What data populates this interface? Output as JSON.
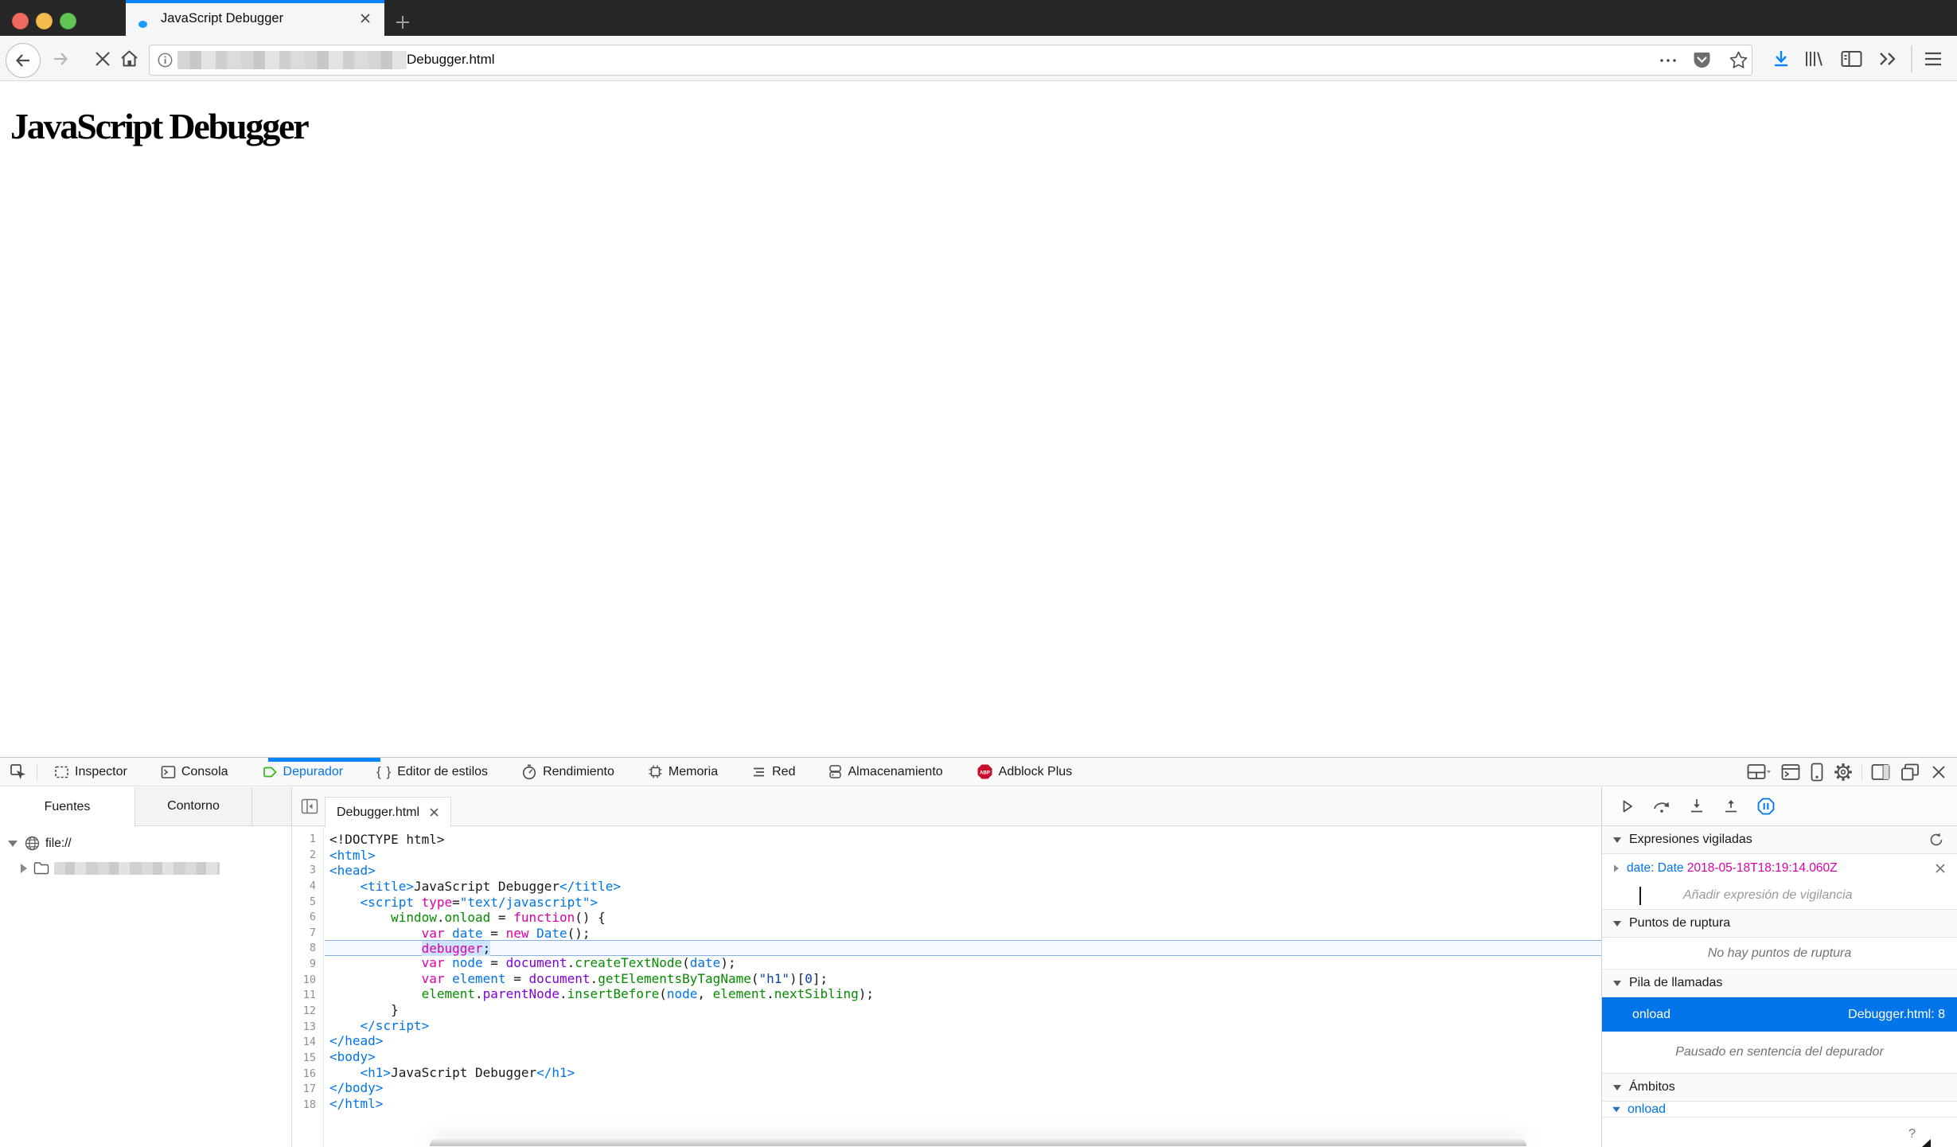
{
  "titlebar": {
    "tab_title": "JavaScript Debugger"
  },
  "navbar": {
    "url_tail": "Debugger.html"
  },
  "page": {
    "heading": "JavaScript Debugger"
  },
  "devtools": {
    "tabs": [
      {
        "id": "inspector",
        "label": "Inspector",
        "active": false
      },
      {
        "id": "console",
        "label": "Consola",
        "active": false
      },
      {
        "id": "debugger",
        "label": "Depurador",
        "active": true
      },
      {
        "id": "styleeditor",
        "label": "Editor de estilos",
        "active": false
      },
      {
        "id": "performance",
        "label": "Rendimiento",
        "active": false
      },
      {
        "id": "memory",
        "label": "Memoria",
        "active": false
      },
      {
        "id": "network",
        "label": "Red",
        "active": false
      },
      {
        "id": "storage",
        "label": "Almacenamiento",
        "active": false
      },
      {
        "id": "adblock",
        "label": "Adblock Plus",
        "active": false
      }
    ],
    "sources": {
      "tab_sources": "Fuentes",
      "tab_outline": "Contorno",
      "root": "file://"
    },
    "editor": {
      "tab": "Debugger.html",
      "paused_line": 8,
      "lines": [
        {
          "n": 1,
          "t": [
            [
              "p",
              "<!DOCTYPE html>"
            ]
          ]
        },
        {
          "n": 2,
          "t": [
            [
              "t",
              "<html>"
            ]
          ]
        },
        {
          "n": 3,
          "t": [
            [
              "t",
              "<head>"
            ]
          ]
        },
        {
          "n": 4,
          "t": [
            [
              "p",
              "    "
            ],
            [
              "t",
              "<title>"
            ],
            [
              "p",
              "JavaScript Debugger"
            ],
            [
              "t",
              "</title>"
            ]
          ]
        },
        {
          "n": 5,
          "t": [
            [
              "p",
              "    "
            ],
            [
              "t",
              "<script"
            ],
            [
              "p",
              " "
            ],
            [
              "a",
              "type"
            ],
            [
              "p",
              "="
            ],
            [
              "sh",
              "\"text/javascript\""
            ],
            [
              "t",
              ">"
            ]
          ]
        },
        {
          "n": 6,
          "t": [
            [
              "p",
              "        "
            ],
            [
              "g",
              "window"
            ],
            [
              "p",
              "."
            ],
            [
              "g",
              "onload"
            ],
            [
              "p",
              " = "
            ],
            [
              "k",
              "function"
            ],
            [
              "p",
              "() {"
            ]
          ]
        },
        {
          "n": 7,
          "t": [
            [
              "p",
              "            "
            ],
            [
              "k",
              "var"
            ],
            [
              "p",
              " "
            ],
            [
              "b",
              "date"
            ],
            [
              "p",
              " = "
            ],
            [
              "k",
              "new"
            ],
            [
              "p",
              " "
            ],
            [
              "b",
              "Date"
            ],
            [
              "p",
              "();"
            ]
          ]
        },
        {
          "n": 8,
          "t": [
            [
              "p",
              "            "
            ],
            [
              "dbg",
              "debugger;"
            ]
          ]
        },
        {
          "n": 9,
          "t": [
            [
              "p",
              "            "
            ],
            [
              "k",
              "var"
            ],
            [
              "p",
              " "
            ],
            [
              "b",
              "node"
            ],
            [
              "p",
              " = "
            ],
            [
              "v",
              "document"
            ],
            [
              "p",
              "."
            ],
            [
              "g",
              "createTextNode"
            ],
            [
              "p",
              "("
            ],
            [
              "b",
              "date"
            ],
            [
              "p",
              ");"
            ]
          ]
        },
        {
          "n": 10,
          "t": [
            [
              "p",
              "            "
            ],
            [
              "k",
              "var"
            ],
            [
              "p",
              " "
            ],
            [
              "b",
              "element"
            ],
            [
              "p",
              " = "
            ],
            [
              "v",
              "document"
            ],
            [
              "p",
              "."
            ],
            [
              "g",
              "getElementsByTagName"
            ],
            [
              "p",
              "("
            ],
            [
              "s",
              "\"h1\""
            ],
            [
              "p",
              ")["
            ],
            [
              "n",
              "0"
            ],
            [
              "p",
              "];"
            ]
          ]
        },
        {
          "n": 11,
          "t": [
            [
              "p",
              "            "
            ],
            [
              "g",
              "element"
            ],
            [
              "p",
              "."
            ],
            [
              "v",
              "parentNode"
            ],
            [
              "p",
              "."
            ],
            [
              "g",
              "insertBefore"
            ],
            [
              "p",
              "("
            ],
            [
              "b",
              "node"
            ],
            [
              "p",
              ", "
            ],
            [
              "g",
              "element"
            ],
            [
              "p",
              "."
            ],
            [
              "g",
              "nextSibling"
            ],
            [
              "p",
              ");"
            ]
          ]
        },
        {
          "n": 12,
          "t": [
            [
              "p",
              "        }"
            ]
          ]
        },
        {
          "n": 13,
          "t": [
            [
              "p",
              "    "
            ],
            [
              "t",
              "</script>"
            ]
          ]
        },
        {
          "n": 14,
          "t": [
            [
              "t",
              "</head>"
            ]
          ]
        },
        {
          "n": 15,
          "t": [
            [
              "t",
              "<body>"
            ]
          ]
        },
        {
          "n": 16,
          "t": [
            [
              "p",
              "    "
            ],
            [
              "t",
              "<h1>"
            ],
            [
              "p",
              "JavaScript Debugger"
            ],
            [
              "t",
              "</h1>"
            ]
          ]
        },
        {
          "n": 17,
          "t": [
            [
              "t",
              "</body>"
            ]
          ]
        },
        {
          "n": 18,
          "t": [
            [
              "t",
              "</html>"
            ]
          ]
        }
      ]
    },
    "panel": {
      "watch_title": "Expresiones vigiladas",
      "watch_name": "date: ",
      "watch_type": "Date ",
      "watch_value": "2018-05-18T18:19:14.060Z",
      "watch_placeholder": "Añadir expresión de vigilancia",
      "breakpoints_title": "Puntos de ruptura",
      "breakpoints_empty": "No hay puntos de ruptura",
      "callstack_title": "Pila de llamadas",
      "frame_name": "onload",
      "frame_location": "Debugger.html: 8",
      "paused_reason": "Pausado en sentencia del depurador",
      "scopes_title": "Ámbitos",
      "scope_name": "onload",
      "help": "?"
    },
    "colors": {
      "accent": "#0a84ff",
      "panel_blue": "#0074e8",
      "keyword": "#dd00a9",
      "green": "#058b00",
      "purple": "#8000d7"
    }
  }
}
